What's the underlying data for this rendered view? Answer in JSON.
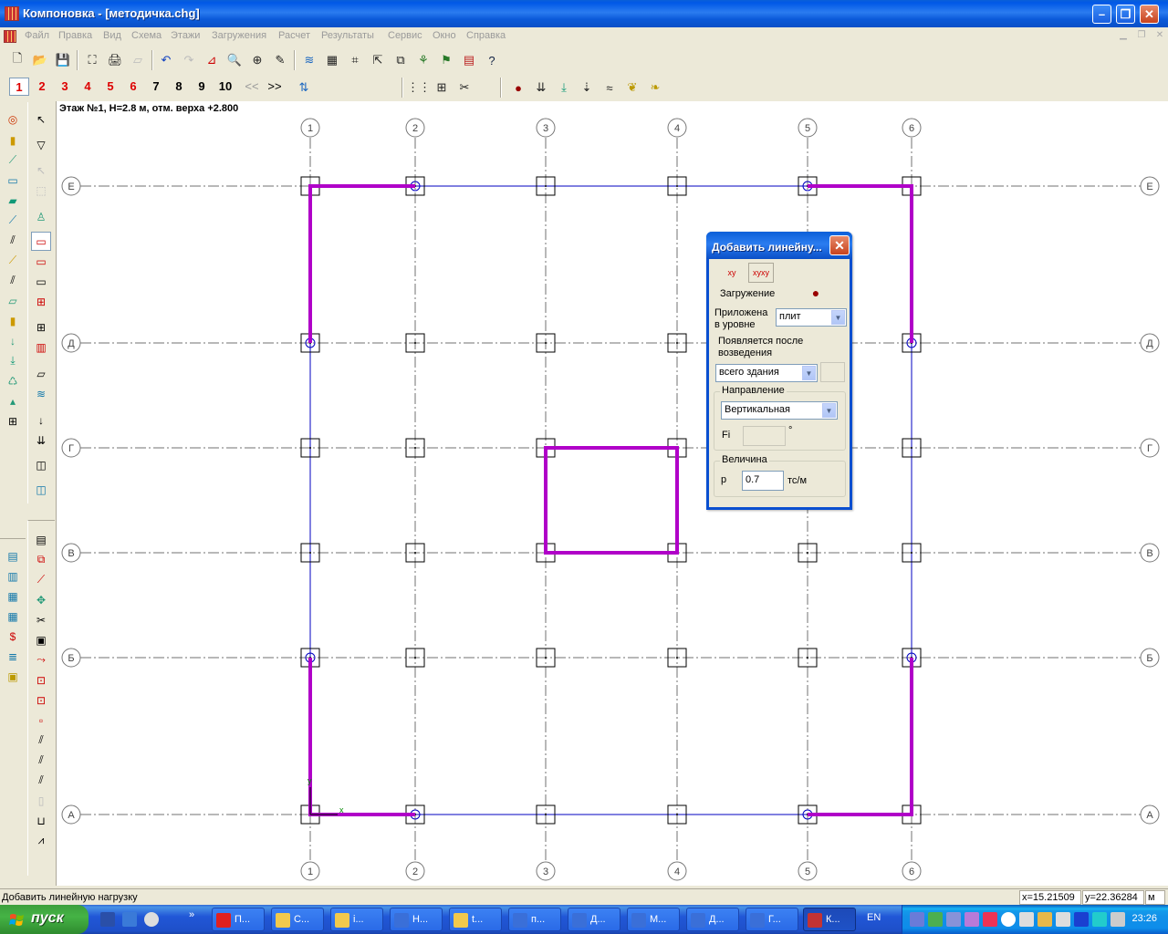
{
  "window": {
    "title": "Компоновка - [методичка.chg]"
  },
  "menu": [
    "Файл",
    "Правка",
    "Вид",
    "Схема",
    "Этажи",
    "Загружения",
    "Расчет",
    "Результаты",
    "Сервис",
    "Окно",
    "Справка"
  ],
  "floors": {
    "numbers": [
      "1",
      "2",
      "3",
      "4",
      "5",
      "6",
      "7",
      "8",
      "9",
      "10"
    ],
    "active": "1",
    "prev": "<<",
    "next": ">>"
  },
  "canvas": {
    "floor_info": "Этаж №1, H=2.8 м, отм. верха +2.800",
    "axes_x": [
      "1",
      "2",
      "3",
      "4",
      "5",
      "6"
    ],
    "axes_y": [
      "Е",
      "Д",
      "Г",
      "В",
      "Б",
      "А"
    ],
    "axis_x_origin_label": "x",
    "axis_y_origin_label": "y",
    "colors": {
      "load_line": "#b000c8",
      "beam_line": "#0000c0",
      "grid_line": "#707070"
    }
  },
  "dialog": {
    "title": "Добавить линейну...",
    "load_case_label": "Загружение",
    "applied_at_level_label": "Приложена в уровне",
    "applied_at_level_value": "плит",
    "appears_after_label": "Появляется после возведения",
    "appears_after_value": "всего здания",
    "direction_group": "Направление",
    "direction_value": "Вертикальная",
    "fi_label": "Fi",
    "degree_symbol": "°",
    "magnitude_group": "Величина",
    "p_label": "p",
    "p_value": "0.7",
    "p_unit": "тс/м"
  },
  "status": {
    "message": "Добавить линейную нагрузку",
    "x": "x=15.21509",
    "y": "y=22.36284",
    "unit": "м"
  },
  "taskbar": {
    "start_label": "пуск",
    "tasks": [
      {
        "label": "П...",
        "color": "#e02020"
      },
      {
        "label": "С...",
        "color": "#f2c94c"
      },
      {
        "label": "i...",
        "color": "#f2c94c"
      },
      {
        "label": "Н...",
        "color": "#3a6fd8"
      },
      {
        "label": "t...",
        "color": "#f2c94c"
      },
      {
        "label": "п...",
        "color": "#3a6fd8"
      },
      {
        "label": "Д...",
        "color": "#3a6fd8"
      },
      {
        "label": "М...",
        "color": "#3a6fd8"
      },
      {
        "label": "Д...",
        "color": "#3a6fd8"
      },
      {
        "label": "Г...",
        "color": "#3a6fd8"
      },
      {
        "label": "К...",
        "color": "#c33333"
      }
    ],
    "language": "EN",
    "clock": "23:26"
  }
}
